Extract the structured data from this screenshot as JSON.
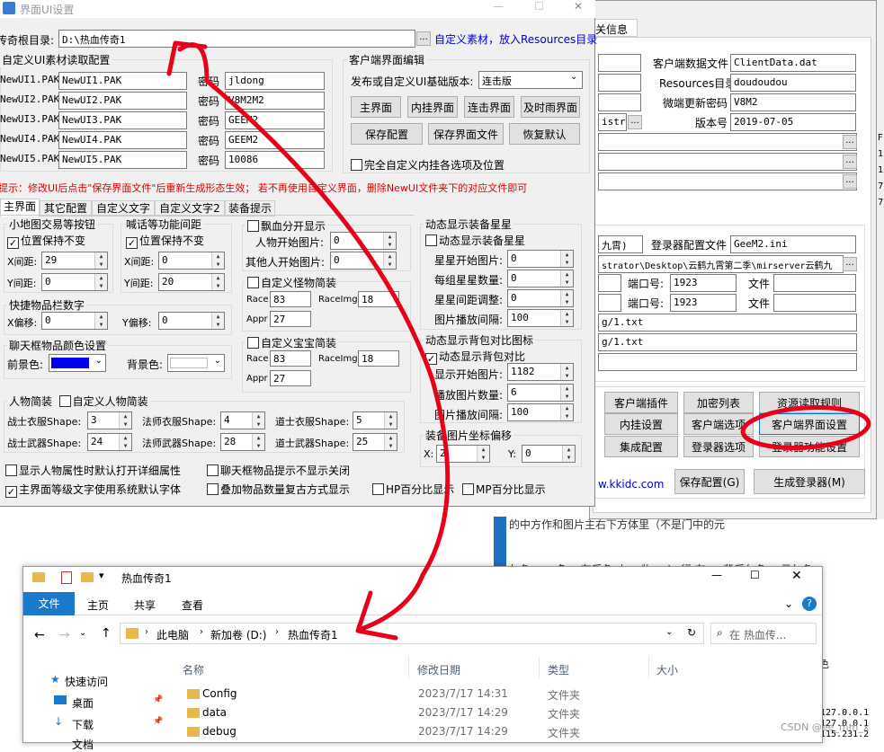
{
  "back_window": {
    "tab_fragment": "关信息",
    "client_data_label": "客户端数据文件",
    "client_data_value": "ClientData.dat",
    "resources_label": "Resources目录",
    "resources_value": "doudoudou",
    "micro_update_label": "微端更新密码",
    "micro_update_value": "V8M2",
    "version_label": "版本号",
    "version_value": "2019-07-05",
    "admin_fragment": "istrat",
    "server_fragment": "九霄)",
    "login_config_label": "登录器配置文件",
    "login_config_value": "GeeM2.ini",
    "path_fragment": "strator\\Desktop\\云鹤九霄第二季\\mirserver云鹤九",
    "port_label": "端口号:",
    "port1": "1923",
    "port2": "1923",
    "file_label": "文件",
    "txt1": "g/1.txt",
    "txt2": "g/1.txt",
    "website_fragment": "w.kkidc.com",
    "buttons": [
      "客户端插件",
      "加密列表",
      "资源读取规则",
      "内挂设置",
      "客户端选项",
      "客户端界面设置",
      "集成配置",
      "登录器选项",
      "登录器功能设置",
      "保存配置(G)",
      "生成登录器(M)"
    ],
    "side_text": [
      "127.0.0.1",
      "127.0.0.1",
      "115.231.2"
    ],
    "csdn": "CSDN @ee_mm_x",
    "bg_texts": [
      "的中方作和图片主右下方体里（不是门中的元",
      "仁色。 ，多 ；有后色 人。 物。 ！ 行 在  ・  背后仁色。 元仁色",
      "色"
    ]
  },
  "ui_window": {
    "title": "界面UI设置",
    "root_label": "传奇根目录:",
    "root_value": "D:\\热血传奇1",
    "root_link": "自定义素材，放入Resources目录",
    "pak_group": "自定义UI素材读取配置",
    "pak_rows": [
      {
        "label": "NewUI1.PAK",
        "value": "NewUI1.PAK",
        "pw_label": "密码",
        "pw": "jldong"
      },
      {
        "label": "NewUI2.PAK",
        "value": "NewUI2.PAK",
        "pw_label": "密码",
        "pw": "V8M2M2"
      },
      {
        "label": "NewUI3.PAK",
        "value": "NewUI3.PAK",
        "pw_label": "密码",
        "pw": "GEEM2"
      },
      {
        "label": "NewUI4.PAK",
        "value": "NewUI4.PAK",
        "pw_label": "密码",
        "pw": "GEEM2"
      },
      {
        "label": "NewUI5.PAK",
        "value": "NewUI5.PAK",
        "pw_label": "密码",
        "pw": "10086"
      }
    ],
    "client_edit_group": "客户端界面编辑",
    "publish_label": "发布或自定义UI基础版本:",
    "publish_value": "连击版",
    "edit_buttons": [
      "主界面",
      "内挂界面",
      "连击界面",
      "及时雨界面"
    ],
    "save_buttons": [
      "保存配置",
      "保存界面文件",
      "恢复默认"
    ],
    "full_custom": "完全自定义内挂各选项及位置",
    "hint": "提示：修改UI后点击\"保存界面文件\"后重新生成形态生效；   若不再使用自定义界面，删除NewUI文件夹下的对应文件即可",
    "tabs": [
      "主界面",
      "其它配置",
      "自定义文字",
      "自定义文字2",
      "装备提示"
    ],
    "minimap_group": "小地图交易等按钮",
    "minimap_keep": "位置保持不变",
    "minimap_x_label": "X间距:",
    "minimap_x": "29",
    "minimap_y_label": "Y间距:",
    "minimap_y": "0",
    "shout_group": "喊话等功能间距",
    "shout_keep": "位置保持不变",
    "shout_x_label": "X间距:",
    "shout_x": "0",
    "shout_y_label": "Y间距:",
    "shout_y": "20",
    "quick_group": "快捷物品栏数字",
    "quick_x_label": "X偏移:",
    "quick_x": "0",
    "quick_y_label": "Y偏移:",
    "quick_y": "0",
    "chat_group": "聊天框物品颜色设置",
    "fg_label": "前景色:",
    "bg_label": "背景色:",
    "blood_label": "飘血分开显示",
    "person_start_label": "人物开始图片:",
    "person_start": "0",
    "other_start_label": "其他人开始图片:",
    "other_start": "0",
    "monster_label": "自定义怪物简装",
    "monster_race": "83",
    "monster_raceimg": "18",
    "monster_appr": "27",
    "baby_label": "自定义宝宝简装",
    "baby_race": "83",
    "baby_raceimg": "18",
    "baby_appr": "27",
    "race_label": "Race",
    "raceimg_label": "RaceImg",
    "appr_label": "Appr",
    "star_group": "动态显示装备星星",
    "star_show": "动态显示装备星星",
    "star_start_label": "星星开始图片:",
    "star_start": "0",
    "star_count_label": "每组星星数量:",
    "star_count": "0",
    "star_gap_label": "星星间距调整:",
    "star_gap": "0",
    "star_interval_label": "图片播放间隔:",
    "star_interval": "100",
    "bag_group": "动态显示背包对比图标",
    "bag_show": "动态显示背包对比",
    "bag_start_label": "显示开始图片:",
    "bag_start": "1182",
    "bag_count_label": "播放图片数量:",
    "bag_count": "6",
    "bag_interval_label": "图片播放间隔:",
    "bag_interval": "100",
    "equip_group": "装备图片坐标偏移",
    "equip_x_label": "X:",
    "equip_x": "2",
    "equip_y_label": "Y:",
    "equip_y": "0",
    "char_group": "人物简装",
    "char_custom": "自定义人物简装",
    "char_rows": [
      {
        "a": "战士衣服Shape:",
        "av": "3",
        "b": "法师衣服Shape:",
        "bv": "4",
        "c": "道士衣服Shape:",
        "cv": "5"
      },
      {
        "a": "战士武器Shape:",
        "av": "24",
        "b": "法师武器Shape:",
        "bv": "28",
        "c": "道士武器Shape:",
        "cv": "25"
      }
    ],
    "opt1": "显示人物属性时默认打开详细属性",
    "opt2": "聊天框物品提示不显示关闭",
    "opt3": "主界面等级文字使用系统默认字体",
    "opt4": "叠加物品数量复古方式显示",
    "opt5": "HP百分比显示",
    "opt6": "MP百分比显示"
  },
  "explorer": {
    "title": "热血传奇1",
    "ribbon_tabs": [
      "文件",
      "主页",
      "共享",
      "查看"
    ],
    "path": [
      "此电脑",
      "新加卷 (D:)",
      "热血传奇1"
    ],
    "search_placeholder": "在 热血传...",
    "columns": [
      "名称",
      "修改日期",
      "类型",
      "大小"
    ],
    "quick_access": "快速访问",
    "nav_items": [
      "桌面",
      "下载",
      "文档"
    ],
    "files": [
      {
        "name": "Config",
        "date": "2023/7/17 14:31",
        "type": "文件夹"
      },
      {
        "name": "data",
        "date": "2023/7/17 14:29",
        "type": "文件夹"
      },
      {
        "name": "debug",
        "date": "2023/7/17 14:29",
        "type": "文件夹"
      }
    ]
  },
  "colors": {
    "annotation": "#e8001a",
    "blue_fg": "#0000ee",
    "link": "#0000cc",
    "hint": "#e00000"
  }
}
